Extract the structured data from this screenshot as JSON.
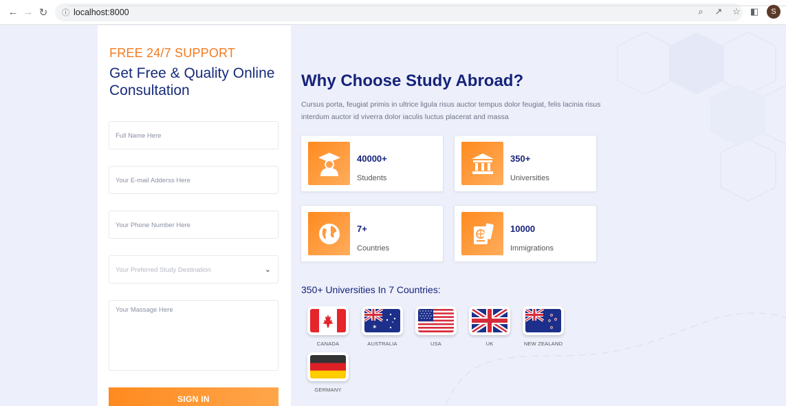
{
  "browser": {
    "url": "localhost:8000",
    "avatar_letter": "S",
    "icons": [
      "back-icon",
      "forward-icon",
      "reload-icon",
      "info-icon",
      "zoom-icon",
      "share-icon",
      "star-icon",
      "sidepanel-icon"
    ]
  },
  "form": {
    "support_label": "FREE 24/7 SUPPORT",
    "title": "Get Free & Quality Online Consultation",
    "fields": {
      "name_placeholder": "Full Name Here",
      "email_placeholder": "Your E-mail Adderss Here",
      "phone_placeholder": "Your Phone Number Here",
      "destination_placeholder": "Your Preferred Study Destination",
      "message_placeholder": "Your Massage Here"
    },
    "submit_label": "SIGN IN"
  },
  "why": {
    "title": "Why Choose Study Abroad?",
    "description": "Cursus porta, feugiat primis in ultrice ligula risus auctor tempus dolor feugiat, felis lacinia risus interdum auctor id viverra dolor iaculis luctus placerat and massa"
  },
  "stats": [
    {
      "value": "40000+",
      "label": "Students",
      "icon": "student-icon"
    },
    {
      "value": "350+",
      "label": "Universities",
      "icon": "university-icon"
    },
    {
      "value": "7+",
      "label": "Countries",
      "icon": "globe-icon"
    },
    {
      "value": "10000",
      "label": "Immigrations",
      "icon": "passport-icon"
    }
  ],
  "countries": {
    "title": "350+ Universities In 7 Countries:",
    "list": [
      "CANADA",
      "AUSTRALIA",
      "USA",
      "UK",
      "NEW ZEALAND",
      "GERMANY"
    ]
  },
  "colors": {
    "accent": "#f47a1f",
    "navy": "#16237a",
    "background": "#edf0fb"
  }
}
